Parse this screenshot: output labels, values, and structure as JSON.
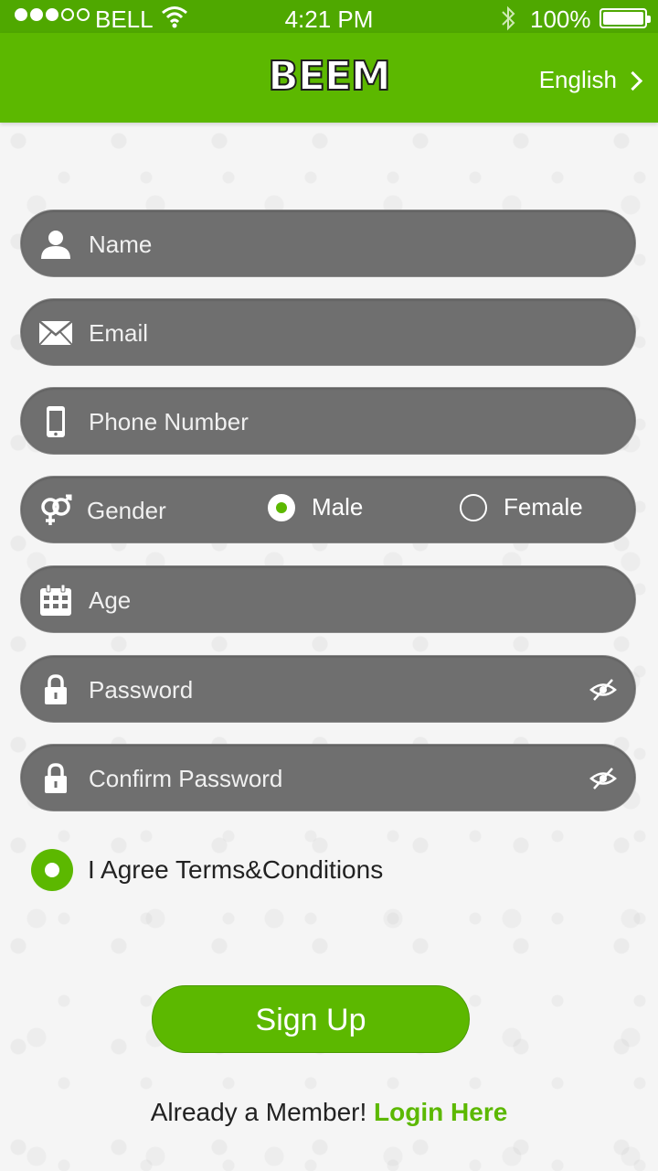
{
  "status_bar": {
    "carrier": "BELL",
    "time": "4:21 PM",
    "battery": "100%",
    "signal_bars": 3,
    "signal_total": 5
  },
  "header": {
    "logo": "BEEM",
    "language": "English"
  },
  "form": {
    "name_placeholder": "Name",
    "email_placeholder": "Email",
    "phone_placeholder": "Phone Number",
    "gender_label": "Gender",
    "gender_male": "Male",
    "gender_female": "Female",
    "gender_selected": "Male",
    "age_placeholder": "Age",
    "password_placeholder": "Password",
    "confirm_password_placeholder": "Confirm Password"
  },
  "terms": {
    "label": "I Agree Terms&Conditions",
    "checked": true
  },
  "actions": {
    "signup": "Sign Up",
    "already_member": "Already a Member!",
    "login": "Login Here"
  },
  "colors": {
    "brand_green": "#5cb800",
    "field_gray": "#6f6f6f"
  }
}
